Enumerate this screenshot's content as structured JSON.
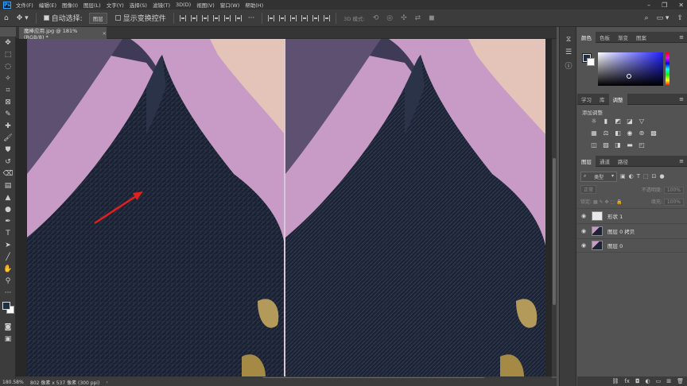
{
  "app": {
    "logo": "Ps"
  },
  "menu": [
    "文件(F)",
    "编辑(E)",
    "图像(I)",
    "图层(L)",
    "文字(Y)",
    "选择(S)",
    "滤镜(T)",
    "3D(D)",
    "视图(V)",
    "窗口(W)",
    "帮助(H)"
  ],
  "options": {
    "auto_select_label": "自动选择:",
    "auto_select_value": "图层",
    "show_transform_label": "显示变换控件",
    "mode_3d_label": "3D 模式:"
  },
  "document": {
    "tab_title": "魔棒应用.jpg @ 181%(RGB/8) *",
    "close": "×"
  },
  "status": {
    "zoom": "180.58%",
    "info": "802 像素 x 537 像素 (300 ppi)",
    "arrow": "›"
  },
  "panels": {
    "color_tabs": [
      "颜色",
      "色板",
      "渐变",
      "图案"
    ],
    "adjust_tabs": [
      "学习",
      "库",
      "调整"
    ],
    "adjust_title": "添加调整",
    "layer_tabs": [
      "图层",
      "通道",
      "路径"
    ],
    "layer_filter": "类型",
    "blend_mode": "正常",
    "opacity_label": "不透明度:",
    "opacity_value": "100%",
    "lock_label": "锁定:",
    "fill_label": "填充:",
    "fill_value": "100%",
    "layers": [
      {
        "name": "形状 1"
      },
      {
        "name": "图层 0 拷贝"
      },
      {
        "name": "图层 0"
      }
    ]
  },
  "colors": {
    "accent": "#31a8ff",
    "foreground": "#1e2f44",
    "background": "#ffffff",
    "arrow": "#e0201c"
  }
}
